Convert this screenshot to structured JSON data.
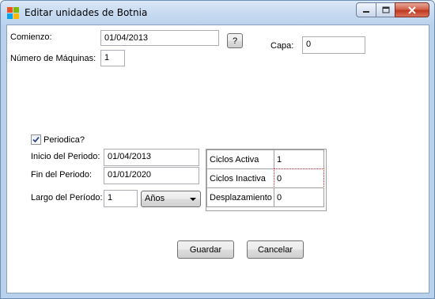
{
  "window": {
    "title": "Editar unidades de Botnia"
  },
  "form": {
    "comienzo_label": "Comienzo:",
    "comienzo_value": "01/04/2013",
    "help_button": "?",
    "capa_label": "Capa:",
    "capa_value": "0",
    "maquinas_label": "Número de Máquinas:",
    "maquinas_value": "1",
    "periodica_label": "Periodica?",
    "periodica_checked": true,
    "inicio_label": "Inicio del Periodo:",
    "inicio_value": "01/04/2013",
    "fin_label": "Fin del Periodo:",
    "fin_value": "01/01/2020",
    "largo_label": "Largo del Período:",
    "largo_value": "1",
    "largo_unit_selected": "Años"
  },
  "grid": {
    "rows": [
      {
        "label": "Ciclos Activa",
        "value": "1"
      },
      {
        "label": "Ciclos Inactiva",
        "value": "0"
      },
      {
        "label": "Desplazamiento",
        "value": "0"
      }
    ]
  },
  "buttons": {
    "save": "Guardar",
    "cancel": "Cancelar"
  },
  "colors": {
    "titlebar": "#c7dbf1",
    "close_button": "#c0391f",
    "check_mark": "#2f4a8a",
    "grid_focus": "#d01818"
  }
}
